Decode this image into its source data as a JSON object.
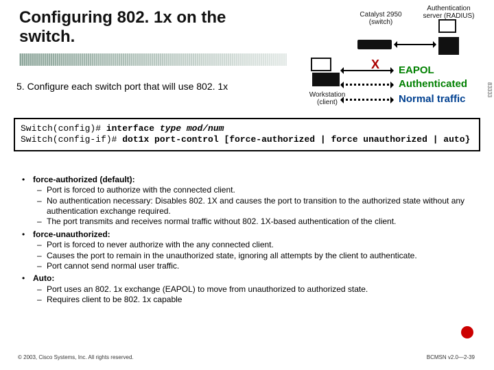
{
  "title": "Configuring 802. 1x on the switch.",
  "step": "5. Configure each switch port that will use 802. 1x",
  "diagram": {
    "switch": "Catalyst 2950\n(switch)",
    "server": "Authentication\nserver\n(RADIUS)",
    "workstation": "Workstation\n(client)",
    "x": "X",
    "eapol": "EAPOL",
    "auth": "Authenticated",
    "normal": "Normal traffic",
    "side_num": "83333"
  },
  "code": {
    "l1a": "Switch(config)# ",
    "l1b": "interface ",
    "l1c": "type mod/num",
    "l2a": "Switch(config-if)# ",
    "l2b": "dot1x port-control [force-authorized | force unauthorized | auto}"
  },
  "items": [
    {
      "head": "force-authorized (default):",
      "sub": [
        "Port is forced to authorize with the connected client.",
        "No authentication necessary: Disables 802. 1X and causes the port to transition to the authorized state without any authentication exchange required.",
        "The port transmits and receives normal traffic without 802. 1X-based authentication of the client."
      ]
    },
    {
      "head": "force-unauthorized:",
      "sub": [
        "Port is forced to never authorize with the any connected client.",
        "Causes the port to remain in the unauthorized state, ignoring all attempts by the client to authenticate.",
        "Port cannot send normal user traffic."
      ]
    },
    {
      "head": "Auto:",
      "sub": [
        "Port uses an 802. 1x exchange (EAPOL) to move from unauthorized to authorized state.",
        "Requires client to be 802. 1x capable"
      ]
    }
  ],
  "footer": {
    "left": "© 2003, Cisco Systems, Inc. All rights reserved.",
    "right": "BCMSN v2.0—2-39"
  }
}
